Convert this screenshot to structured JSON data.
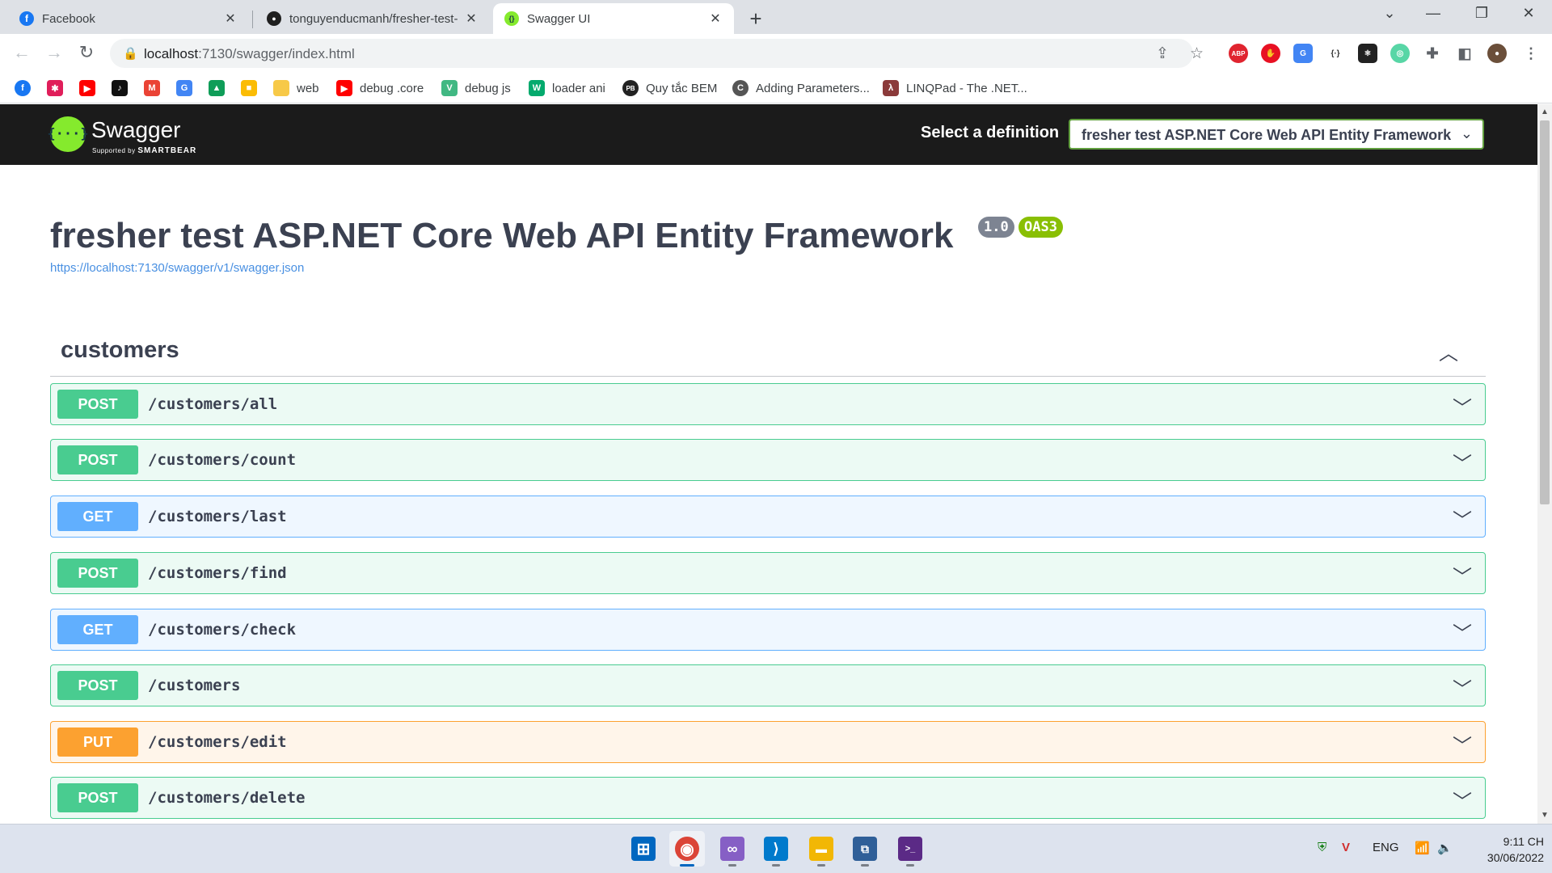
{
  "browser": {
    "tabs": [
      {
        "title": "Facebook",
        "icon": "facebook-icon",
        "color": "#1877f2",
        "glyph": "f"
      },
      {
        "title": "tonguyenducmanh/fresher-test-",
        "icon": "github-icon",
        "color": "#1f1f1f",
        "glyph": "●"
      },
      {
        "title": "Swagger UI",
        "icon": "swagger-icon",
        "color": "#85ea2d",
        "glyph": "{}"
      }
    ],
    "new_tab": "+",
    "address": {
      "host": "localhost",
      "path": ":7130/swagger/index.html"
    },
    "bookmarks": [
      {
        "label": "",
        "icon": "facebook-icon",
        "color": "#1877f2",
        "glyph": "f"
      },
      {
        "label": "",
        "icon": "slack-icon",
        "color": "#e01e5a",
        "glyph": "✱"
      },
      {
        "label": "",
        "icon": "youtube-icon",
        "color": "#ff0000",
        "glyph": "▶"
      },
      {
        "label": "",
        "icon": "tiktok-icon",
        "color": "#111111",
        "glyph": "♪"
      },
      {
        "label": "",
        "icon": "gmail-icon",
        "color": "#ea4335",
        "glyph": "M"
      },
      {
        "label": "",
        "icon": "translate-icon",
        "color": "#4285f4",
        "glyph": "G"
      },
      {
        "label": "",
        "icon": "drive-icon",
        "color": "#0f9d58",
        "glyph": "▲"
      },
      {
        "label": "",
        "icon": "keep-icon",
        "color": "#fbbc04",
        "glyph": "■"
      },
      {
        "label": "web",
        "icon": "folder-icon",
        "color": "#f7c948",
        "glyph": ""
      },
      {
        "label": "debug .core",
        "icon": "youtube-icon",
        "color": "#ff0000",
        "glyph": "▶"
      },
      {
        "label": "debug js",
        "icon": "vuejs-icon",
        "color": "#41b883",
        "glyph": "V"
      },
      {
        "label": "loader ani",
        "icon": "w3-icon",
        "color": "#04aa6d",
        "glyph": "W"
      },
      {
        "label": "Quy tắc BEM",
        "icon": "pb-icon",
        "color": "#222222",
        "glyph": "PB"
      },
      {
        "label": "Adding Parameters...",
        "icon": "csharpcorner-icon",
        "color": "#555555",
        "glyph": "C"
      },
      {
        "label": "LINQPad - The .NET...",
        "icon": "linqpad-icon",
        "color": "#8b3a3a",
        "glyph": "λ"
      }
    ]
  },
  "swagger": {
    "logo_text": "Swagger",
    "logo_glyph": "{···}",
    "logo_sub": "Supported by",
    "logo_sub_brand": "SMARTBEAR",
    "definition_label": "Select a definition",
    "definition_value": "fresher test ASP.NET Core Web API Entity Framework",
    "title": "fresher test ASP.NET Core Web API Entity Framework",
    "version": "1.0",
    "oas": "OAS3",
    "spec_url": "https://localhost:7130/swagger/v1/swagger.json",
    "tag": "customers",
    "operations": [
      {
        "method": "POST",
        "path": "/customers/all"
      },
      {
        "method": "POST",
        "path": "/customers/count"
      },
      {
        "method": "GET",
        "path": "/customers/last"
      },
      {
        "method": "POST",
        "path": "/customers/find"
      },
      {
        "method": "GET",
        "path": "/customers/check"
      },
      {
        "method": "POST",
        "path": "/customers"
      },
      {
        "method": "PUT",
        "path": "/customers/edit"
      },
      {
        "method": "POST",
        "path": "/customers/delete"
      }
    ]
  },
  "taskbar": {
    "apps": [
      {
        "name": "start-icon",
        "color": "#0067c0",
        "glyph": "⊞"
      },
      {
        "name": "chrome-icon",
        "color": "#db4437",
        "glyph": "◉"
      },
      {
        "name": "visual-studio-icon",
        "color": "#865fc5",
        "glyph": "∞"
      },
      {
        "name": "vscode-icon",
        "color": "#007acc",
        "glyph": "⟩"
      },
      {
        "name": "file-explorer-icon",
        "color": "#f2b705",
        "glyph": "▬"
      },
      {
        "name": "sql-server-icon",
        "color": "#2f5f98",
        "glyph": "⧉"
      },
      {
        "name": "terminal-icon",
        "color": "#5b2a86",
        "glyph": ">_"
      }
    ],
    "language": "ENG",
    "time": "9:11 CH",
    "date": "30/06/2022"
  }
}
